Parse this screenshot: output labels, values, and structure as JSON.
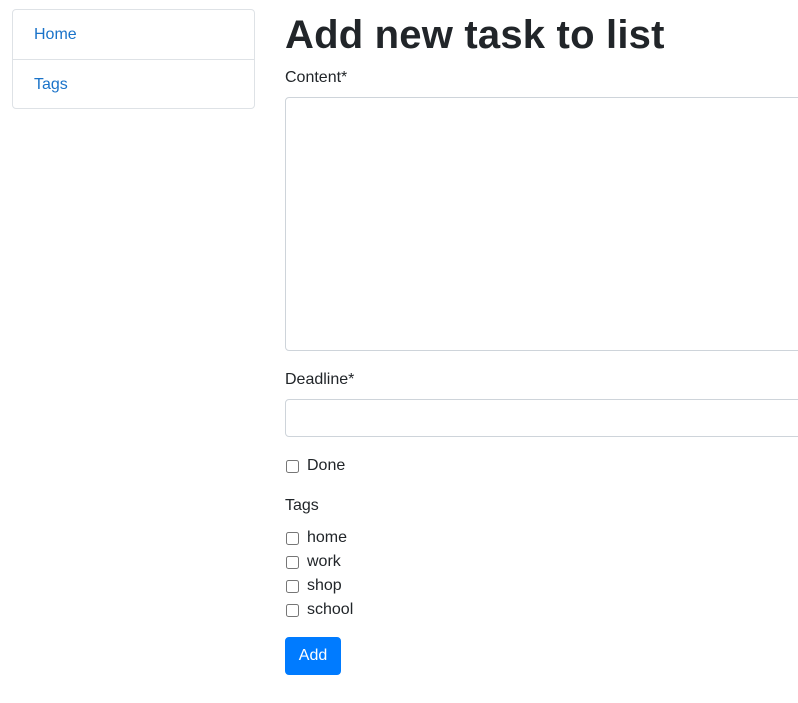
{
  "sidebar": {
    "items": [
      {
        "label": "Home"
      },
      {
        "label": "Tags"
      }
    ]
  },
  "main": {
    "title": "Add new task to list",
    "content_label": "Content*",
    "content_value": "",
    "deadline_label": "Deadline*",
    "deadline_value": "",
    "done_label": "Done",
    "done_checked": false,
    "tags_label": "Tags",
    "tags": [
      {
        "label": "home",
        "checked": false
      },
      {
        "label": "work",
        "checked": false
      },
      {
        "label": "shop",
        "checked": false
      },
      {
        "label": "school",
        "checked": false
      }
    ],
    "submit_label": "Add"
  },
  "colors": {
    "link": "#1a73c9",
    "primary": "#007bff",
    "border": "#dee2e6"
  }
}
